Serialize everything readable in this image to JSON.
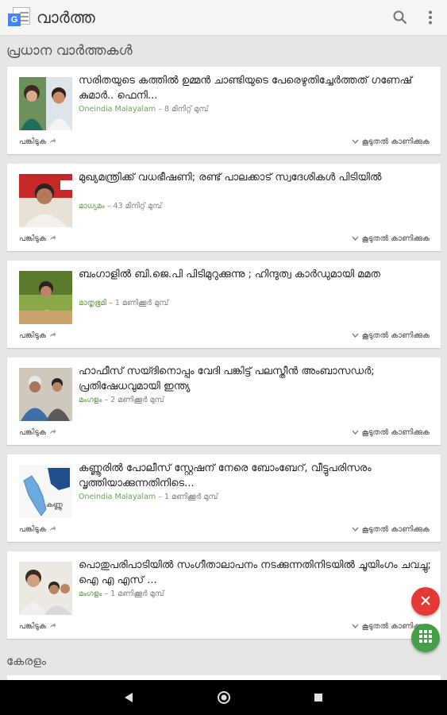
{
  "app": {
    "title": "വാർത്ത",
    "logo_letter": "G"
  },
  "colors": {
    "source_green": "#6aa44b",
    "fab_close": "#e53935",
    "fab_grid": "#43a047"
  },
  "sections": {
    "top_stories": "പ്രധാന വാർത്തകൾ",
    "kerala": "കേരളം"
  },
  "labels": {
    "share": "പങ്കിടുക",
    "more": "കൂടുതൽ കാണിക്കുക"
  },
  "stories": [
    {
      "headline": "സരിതയുടെ കത്തിൽ ഉമ്മൻ ചാണ്ടിയുടെ പേരെഴുതിച്ചേർത്തത് ഗണേഷ് കുമാർ.. ഫെനി...",
      "source": "Oneindia Malayalam",
      "time": "8 മിനിറ്റ് മുമ്പ്"
    },
    {
      "headline": "മുഖ്യമന്ത്രിക്ക് വധഭീഷണി; രണ്ട് പാലക്കാട് സ്വദേശികൾ പിടിയിൽ",
      "source": "മാധ്യമം",
      "time": "43 മിനിറ്റ് മുമ്പ്"
    },
    {
      "headline": "ബംഗാളിൽ ബി.ജെ.പി പിടിമുറുക്കുന്നു ; ഹിന്ദുത്വ കാർഡുമായി മമത",
      "source": "മാതൃഭൂമി",
      "time": "1 മണിക്കൂർ മുമ്പ്"
    },
    {
      "headline": "ഹാഫീസ് സയ്ദിനൊപ്പം വേദി പങ്കിട്ട് പലസ്തീൻ അംബാസഡർ; പ്രതിഷേധവുമായി ഇന്ത്യ",
      "source": "മംഗളം",
      "time": "2 മണിക്കൂർ മുമ്പ്"
    },
    {
      "headline": "കണ്ണൂരിൽ പോലീസ് സ്റ്റേഷന് നേരെ ബോംബേറ്, വീട്ടുപരിസരം വൃത്തിയാക്കുന്നതിനിടെ...",
      "source": "Oneindia Malayalam",
      "time": "1 മണിക്കൂർ മുമ്പ്"
    },
    {
      "headline": "പൊതുപരിപാടിയിൽ സംഗീതാലാപനം നടക്കുന്നതിനിടയിൽ ചൂയിംഗം ചവച്ചു; ഐ എ എസ് ...",
      "source": "മംഗളം",
      "time": "1 മണിക്കൂർ മുമ്പ്"
    }
  ],
  "thumb_label_kannur": "കണ്ണൂ",
  "icons": {
    "search": "search-icon",
    "overflow": "more-vert-icon",
    "share": "share-arrow-icon",
    "expand": "chevron-down-icon",
    "close": "close-icon",
    "grid": "apps-grid-icon",
    "back": "back-triangle-icon",
    "home": "home-circle-icon",
    "recents": "recents-square-icon"
  }
}
